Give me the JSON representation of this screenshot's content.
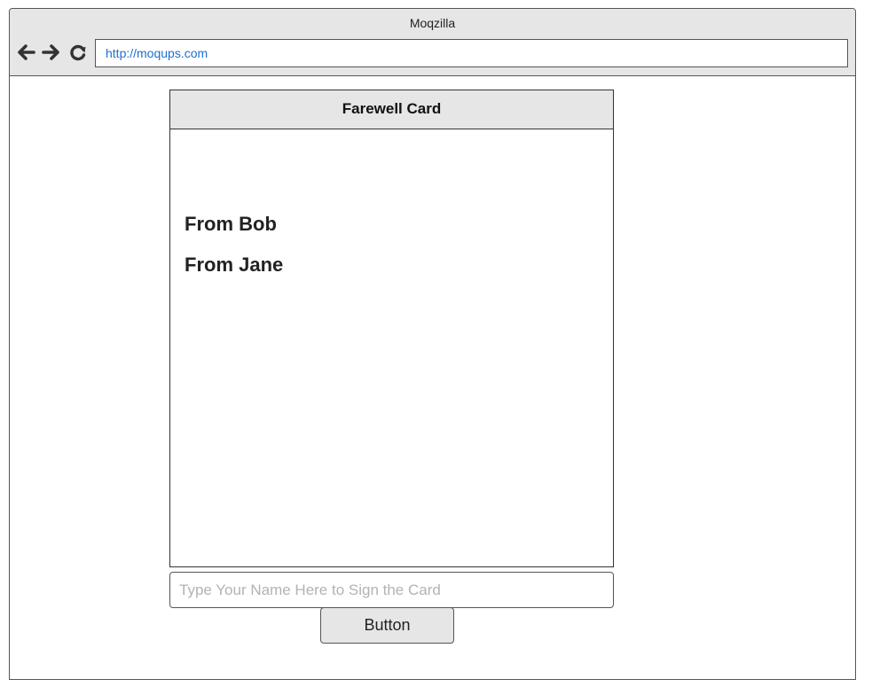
{
  "window": {
    "title": "Moqzilla"
  },
  "toolbar": {
    "back_icon": "arrow-left-icon",
    "forward_icon": "arrow-right-icon",
    "reload_icon": "reload-icon",
    "url": "http://moqups.com"
  },
  "card": {
    "title": "Farewell Card",
    "signatures": [
      "From Bob",
      "From Jane"
    ]
  },
  "form": {
    "name_placeholder": "Type Your Name Here to Sign the Card",
    "name_value": "",
    "button_label": "Button"
  },
  "colors": {
    "chrome_bg": "#e6e6e6",
    "url_text": "#1e6fcf",
    "placeholder_text": "#b3b3b3"
  }
}
